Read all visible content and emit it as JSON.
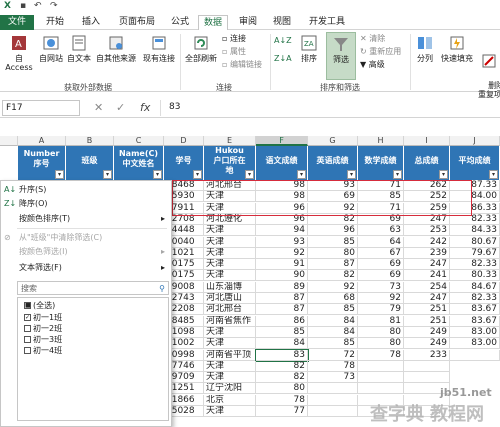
{
  "tabs": [
    "文件",
    "开始",
    "插入",
    "页面布局",
    "公式",
    "数据",
    "审阅",
    "视图",
    "开发工具"
  ],
  "ribbon": {
    "access": "自 Access",
    "web": "自网站",
    "text": "自文本",
    "other": "自其他来源",
    "existing": "现有连接",
    "refresh": "全部刷新",
    "conn": "连接",
    "props": "属性",
    "editlinks": "编辑链接",
    "sort": "排序",
    "filter": "筛选",
    "clear": "清除",
    "reapply": "重新应用",
    "advanced": "高级",
    "split": "分列",
    "flash": "快速填充",
    "dup": "删除\n重复项",
    "group_ext": "获取外部数据",
    "group_conn": "连接",
    "group_sort": "排序和筛选"
  },
  "formula": {
    "namebox": "F17",
    "fx": "fx",
    "value": "83"
  },
  "columns": [
    "A",
    "B",
    "C",
    "D",
    "E",
    "F",
    "G",
    "H",
    "I",
    "J"
  ],
  "headers": [
    "Number\n序号",
    "班级",
    "Name(C)\n中文姓名",
    "学号",
    "Hukou\n户口所在\n地",
    "语文成绩",
    "英语成绩",
    "数学成绩",
    "总成绩",
    "平均成绩"
  ],
  "rows": [
    [
      "18468",
      "河北邢台",
      "98",
      "93",
      "71",
      "262",
      "87.33"
    ],
    [
      "05930",
      "天津",
      "98",
      "69",
      "85",
      "252",
      "84.00"
    ],
    [
      "17911",
      "天津",
      "96",
      "92",
      "71",
      "259",
      "86.33"
    ],
    [
      "22708",
      "河北遵化",
      "96",
      "82",
      "69",
      "247",
      "82.33"
    ],
    [
      "14448",
      "天津",
      "94",
      "96",
      "63",
      "253",
      "84.33"
    ],
    [
      "10040",
      "天津",
      "93",
      "85",
      "64",
      "242",
      "80.67"
    ],
    [
      "01021",
      "天津",
      "92",
      "80",
      "67",
      "239",
      "79.67"
    ],
    [
      "20175",
      "天津",
      "91",
      "87",
      "69",
      "247",
      "82.33"
    ],
    [
      "20175",
      "天津",
      "90",
      "82",
      "69",
      "241",
      "80.33"
    ],
    [
      "09008",
      "山东淄博",
      "89",
      "92",
      "73",
      "254",
      "84.67"
    ],
    [
      "12743",
      "河北唐山",
      "87",
      "68",
      "92",
      "247",
      "82.33"
    ],
    [
      "22208",
      "河北邢台",
      "87",
      "85",
      "79",
      "251",
      "83.67"
    ],
    [
      "28485",
      "河南省焦作",
      "86",
      "84",
      "81",
      "251",
      "83.67"
    ],
    [
      "21098",
      "天津",
      "85",
      "84",
      "80",
      "249",
      "83.00"
    ],
    [
      "21002",
      "天津",
      "84",
      "85",
      "80",
      "249",
      "83.00"
    ],
    [
      "30998",
      "河南省平顶",
      "83",
      "72",
      "78",
      "233",
      ""
    ],
    [
      "27746",
      "天津",
      "82",
      "78",
      "",
      ""
    ],
    [
      "09709",
      "天津",
      "82",
      "73",
      "",
      ""
    ],
    [
      "11251",
      "辽宁沈阳",
      "80",
      "",
      "",
      ""
    ],
    [
      "11866",
      "北京",
      "78",
      "",
      "",
      ""
    ],
    [
      "15028",
      "天津",
      "77",
      "",
      "",
      ""
    ]
  ],
  "menu": {
    "asc": "升序(S)",
    "desc": "降序(O)",
    "bycolor": "按颜色排序(T)",
    "clearfilter": "从\"班级\"中清除筛选(C)",
    "colorfilter": "按颜色筛选(I)",
    "textfilter": "文本筛选(F)",
    "search": "搜索",
    "all": "(全选)",
    "items": [
      "初一1班",
      "初一2班",
      "初一3班",
      "初一4班"
    ]
  },
  "watermark": {
    "site": "jb51.net",
    "text1": "查字典",
    "text2": "教程网"
  }
}
